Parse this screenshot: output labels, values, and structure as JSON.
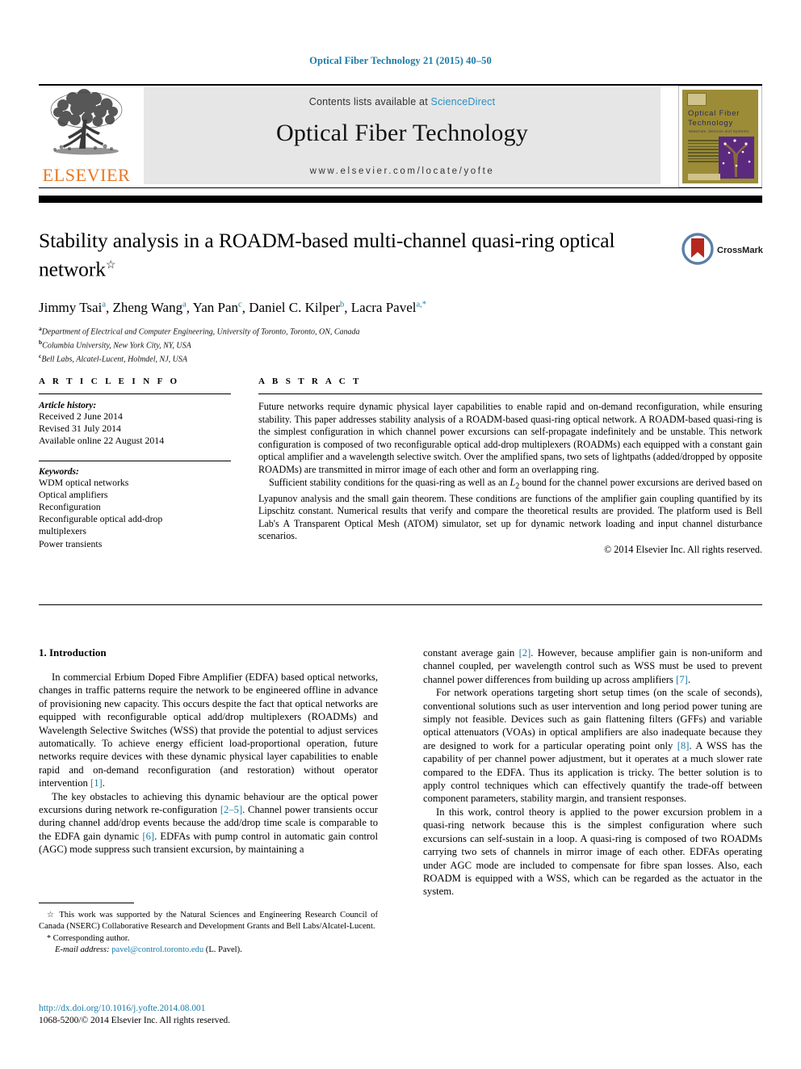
{
  "running_head": "Optical Fiber Technology 21 (2015) 40–50",
  "header": {
    "contents_prefix": "Contents lists available at ",
    "sciencedirect": "ScienceDirect",
    "journal_title": "Optical Fiber Technology",
    "journal_url": "www.elsevier.com/locate/yofte",
    "publisher_name": "ELSEVIER",
    "cover": {
      "line1": "Optical Fiber",
      "line2": "Technology",
      "line3": "Materials, Devices and Systems"
    }
  },
  "article": {
    "title": "Stability analysis in a ROADM-based multi-channel quasi-ring optical network",
    "title_footnote_mark": "☆",
    "crossmark_label": "CrossMark",
    "authors": [
      {
        "name": "Jimmy Tsai",
        "sup": "a"
      },
      {
        "name": "Zheng Wang",
        "sup": "a"
      },
      {
        "name": "Yan Pan",
        "sup": "c"
      },
      {
        "name": "Daniel C. Kilper",
        "sup": "b"
      },
      {
        "name": "Lacra Pavel",
        "sup": "a,*"
      }
    ],
    "affiliations": [
      {
        "mark": "a",
        "text": "Department of Electrical and Computer Engineering, University of Toronto, Toronto, ON, Canada"
      },
      {
        "mark": "b",
        "text": "Columbia University, New York City, NY, USA"
      },
      {
        "mark": "c",
        "text": "Bell Labs, Alcatel-Lucent, Holmdel, NJ, USA"
      }
    ]
  },
  "article_info": {
    "heading": "A R T I C L E    I N F O",
    "history_label": "Article history:",
    "history": [
      "Received 2 June 2014",
      "Revised 31 July 2014",
      "Available online 22 August 2014"
    ],
    "keywords_label": "Keywords:",
    "keywords": [
      "WDM optical networks",
      "Optical amplifiers",
      "Reconfiguration",
      "Reconfigurable optical add-drop",
      "multiplexers",
      "Power transients"
    ]
  },
  "abstract": {
    "heading": "A B S T R A C T",
    "paragraph1": "Future networks require dynamic physical layer capabilities to enable rapid and on-demand reconfiguration, while ensuring stability. This paper addresses stability analysis of a ROADM-based quasi-ring optical network. A ROADM-based quasi-ring is the simplest configuration in which channel power excursions can self-propagate indefinitely and be unstable. This network configuration is composed of two reconfigurable optical add-drop multiplexers (ROADMs) each equipped with a constant gain optical amplifier and a wavelength selective switch. Over the amplified spans, two sets of lightpaths (added/dropped by opposite ROADMs) are transmitted in mirror image of each other and form an overlapping ring.",
    "paragraph2_pre": "Sufficient stability conditions for the quasi-ring as well as an ",
    "paragraph2_math": "L",
    "paragraph2_sub": "2",
    "paragraph2_post": " bound for the channel power excursions are derived based on Lyapunov analysis and the small gain theorem. These conditions are functions of the amplifier gain coupling quantified by its Lipschitz constant. Numerical results that verify and compare the theoretical results are provided. The platform used is Bell Lab's A Transparent Optical Mesh (ATOM) simulator, set up for dynamic network loading and input channel disturbance scenarios.",
    "copyright": "© 2014 Elsevier Inc. All rights reserved."
  },
  "body": {
    "section_title": "1. Introduction",
    "left_paragraphs": [
      "In commercial Erbium Doped Fibre Amplifier (EDFA) based optical networks, changes in traffic patterns require the network to be engineered offline in advance of provisioning new capacity. This occurs despite the fact that optical networks are equipped with reconfigurable optical add/drop multiplexers (ROADMs) and Wavelength Selective Switches (WSS) that provide the potential to adjust services automatically. To achieve energy efficient load-proportional operation, future networks require devices with these dynamic physical layer capabilities to enable rapid and on-demand reconfiguration (and restoration) without operator intervention [1].",
      "The key obstacles to achieving this dynamic behaviour are the optical power excursions during network re-configuration [2–5]. Channel power transients occur during channel add/drop events because the add/drop time scale is comparable to the EDFA gain dynamic [6]. EDFAs with pump control in automatic gain control (AGC) mode suppress such transient excursion, by maintaining a"
    ],
    "right_paragraphs": [
      "constant average gain [2]. However, because amplifier gain is non-uniform and channel coupled, per wavelength control such as WSS must be used to prevent channel power differences from building up across amplifiers [7].",
      "For network operations targeting short setup times (on the scale of seconds), conventional solutions such as user intervention and long period power tuning are simply not feasible. Devices such as gain flattening filters (GFFs) and variable optical attenuators (VOAs) in optical amplifiers are also inadequate because they are designed to work for a particular operating point only [8]. A WSS has the capability of per channel power adjustment, but it operates at a much slower rate compared to the EDFA. Thus its application is tricky. The better solution is to apply control techniques which can effectively quantify the trade-off between component parameters, stability margin, and transient responses.",
      "In this work, control theory is applied to the power excursion problem in a quasi-ring network because this is the simplest configuration where such excursions can self-sustain in a loop. A quasi-ring is composed of two ROADMs carrying two sets of channels in mirror image of each other. EDFAs operating under AGC mode are included to compensate for fibre span losses. Also, each ROADM is equipped with a WSS, which can be regarded as the actuator in the system."
    ],
    "reference_marks": [
      "[1]",
      "[2–5]",
      "[6]",
      "[2]",
      "[7]",
      "[8]"
    ]
  },
  "footnotes": {
    "funding_mark": "☆",
    "funding": "This work was supported by the Natural Sciences and Engineering Research Council of Canada (NSERC) Collaborative Research and Development Grants and Bell Labs/Alcatel-Lucent.",
    "corresponding_mark": "*",
    "corresponding": "Corresponding author.",
    "email_label": "E-mail address:",
    "email": "pavel@control.toronto.edu",
    "email_owner": "(L. Pavel)."
  },
  "footer": {
    "doi": "http://dx.doi.org/10.1016/j.yofte.2014.08.001",
    "issn_line": "1068-5200/© 2014 Elsevier Inc. All rights reserved."
  },
  "colors": {
    "link": "#1a7ba8",
    "elsevier_orange": "#E87722",
    "sciencedirect_blue": "#2a8fc4"
  }
}
